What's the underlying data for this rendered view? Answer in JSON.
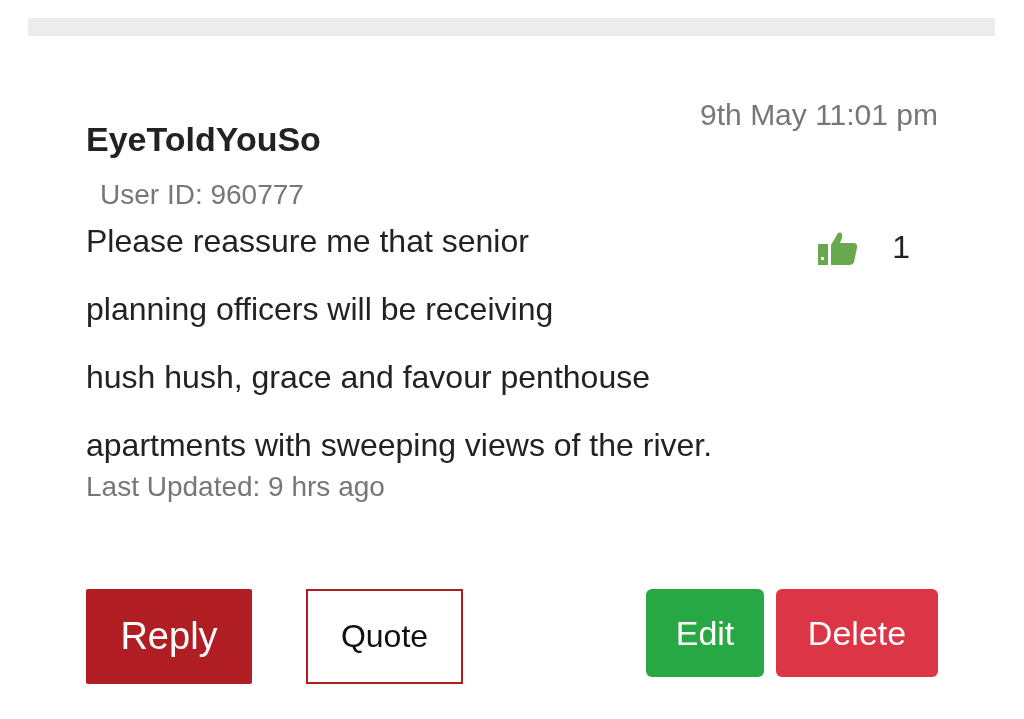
{
  "comment": {
    "author": "EyeToldYouSo",
    "date": "9th May 11:01 pm",
    "user_id": "User ID: 960777",
    "text": "Please reassure me that senior\nplanning officers will be receiving\nhush hush, grace and favour penthouse\napartments with sweeping views of the river.",
    "likes": "1",
    "last_updated": "Last Updated: 9 hrs ago"
  },
  "buttons": [
    {
      "label": "Reply",
      "kind": "primary"
    },
    {
      "label": "Quote",
      "kind": "outline"
    },
    {
      "label": "Edit",
      "kind": "success"
    },
    {
      "label": "Delete",
      "kind": "danger"
    }
  ]
}
